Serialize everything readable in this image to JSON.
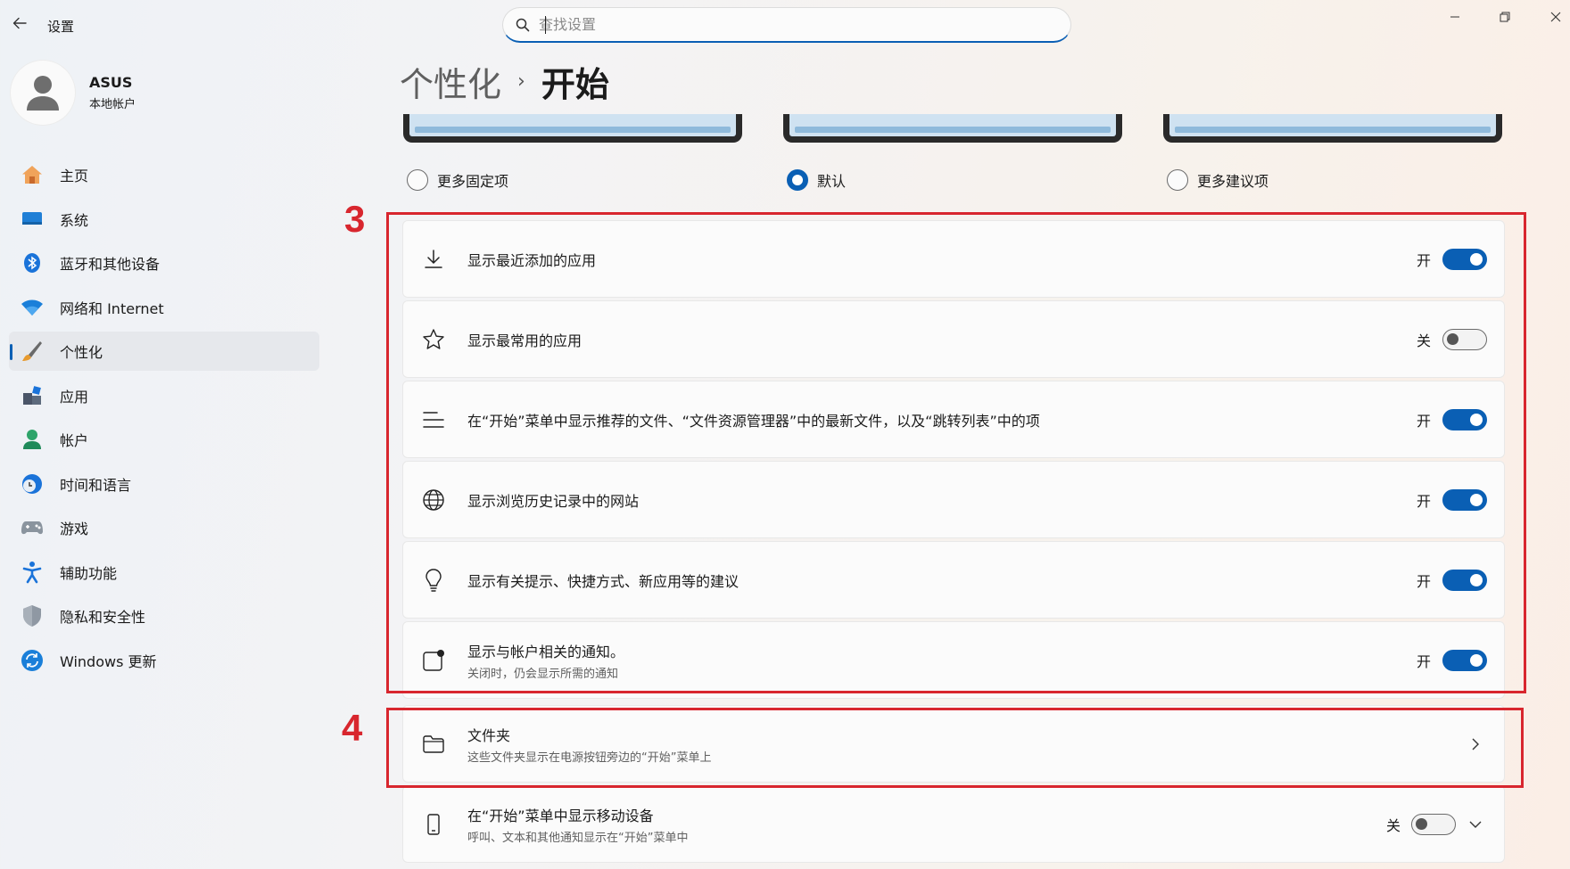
{
  "window": {
    "title": "设置",
    "search_placeholder": "查找设置"
  },
  "profile": {
    "name": "ASUS",
    "account_type": "本地帐户"
  },
  "sidebar": {
    "items": [
      {
        "label": "主页",
        "icon": "home-icon"
      },
      {
        "label": "系统",
        "icon": "system-icon"
      },
      {
        "label": "蓝牙和其他设备",
        "icon": "bluetooth-icon"
      },
      {
        "label": "网络和 Internet",
        "icon": "wifi-icon"
      },
      {
        "label": "个性化",
        "icon": "brush-icon",
        "active": true
      },
      {
        "label": "应用",
        "icon": "apps-icon"
      },
      {
        "label": "帐户",
        "icon": "account-icon"
      },
      {
        "label": "时间和语言",
        "icon": "clock-globe-icon"
      },
      {
        "label": "游戏",
        "icon": "gamepad-icon"
      },
      {
        "label": "辅助功能",
        "icon": "accessibility-icon"
      },
      {
        "label": "隐私和安全性",
        "icon": "shield-icon"
      },
      {
        "label": "Windows 更新",
        "icon": "update-icon"
      }
    ]
  },
  "breadcrumb": {
    "parent": "个性化",
    "separator": "›",
    "current": "开始"
  },
  "layout_options": [
    {
      "label": "更多固定项",
      "selected": false
    },
    {
      "label": "默认",
      "selected": true
    },
    {
      "label": "更多建议项",
      "selected": false
    }
  ],
  "settings": [
    {
      "title": "显示最近添加的应用",
      "subtitle": "",
      "state_label": "开",
      "on": true,
      "icon": "download-icon"
    },
    {
      "title": "显示最常用的应用",
      "subtitle": "",
      "state_label": "关",
      "on": false,
      "icon": "star-icon"
    },
    {
      "title": "在“开始”菜单中显示推荐的文件、“文件资源管理器”中的最新文件，以及“跳转列表”中的项",
      "subtitle": "",
      "state_label": "开",
      "on": true,
      "icon": "list-icon"
    },
    {
      "title": "显示浏览历史记录中的网站",
      "subtitle": "",
      "state_label": "开",
      "on": true,
      "icon": "globe-icon"
    },
    {
      "title": "显示有关提示、快捷方式、新应用等的建议",
      "subtitle": "",
      "state_label": "开",
      "on": true,
      "icon": "lightbulb-icon"
    },
    {
      "title": "显示与帐户相关的通知。",
      "subtitle": "关闭时，仍会显示所需的通知",
      "state_label": "开",
      "on": true,
      "icon": "notification-icon"
    }
  ],
  "folders": {
    "title": "文件夹",
    "subtitle": "这些文件夹显示在电源按钮旁边的“开始”菜单上",
    "icon": "folder-icon"
  },
  "mobile": {
    "title": "在“开始”菜单中显示移动设备",
    "subtitle": "呼叫、文本和其他通知显示在“开始”菜单中",
    "state_label": "关",
    "on": false,
    "icon": "phone-icon"
  },
  "annotations": {
    "label_3": "3",
    "label_4": "4",
    "color": "#d8262e"
  },
  "colors": {
    "accent": "#0a5fb4"
  }
}
